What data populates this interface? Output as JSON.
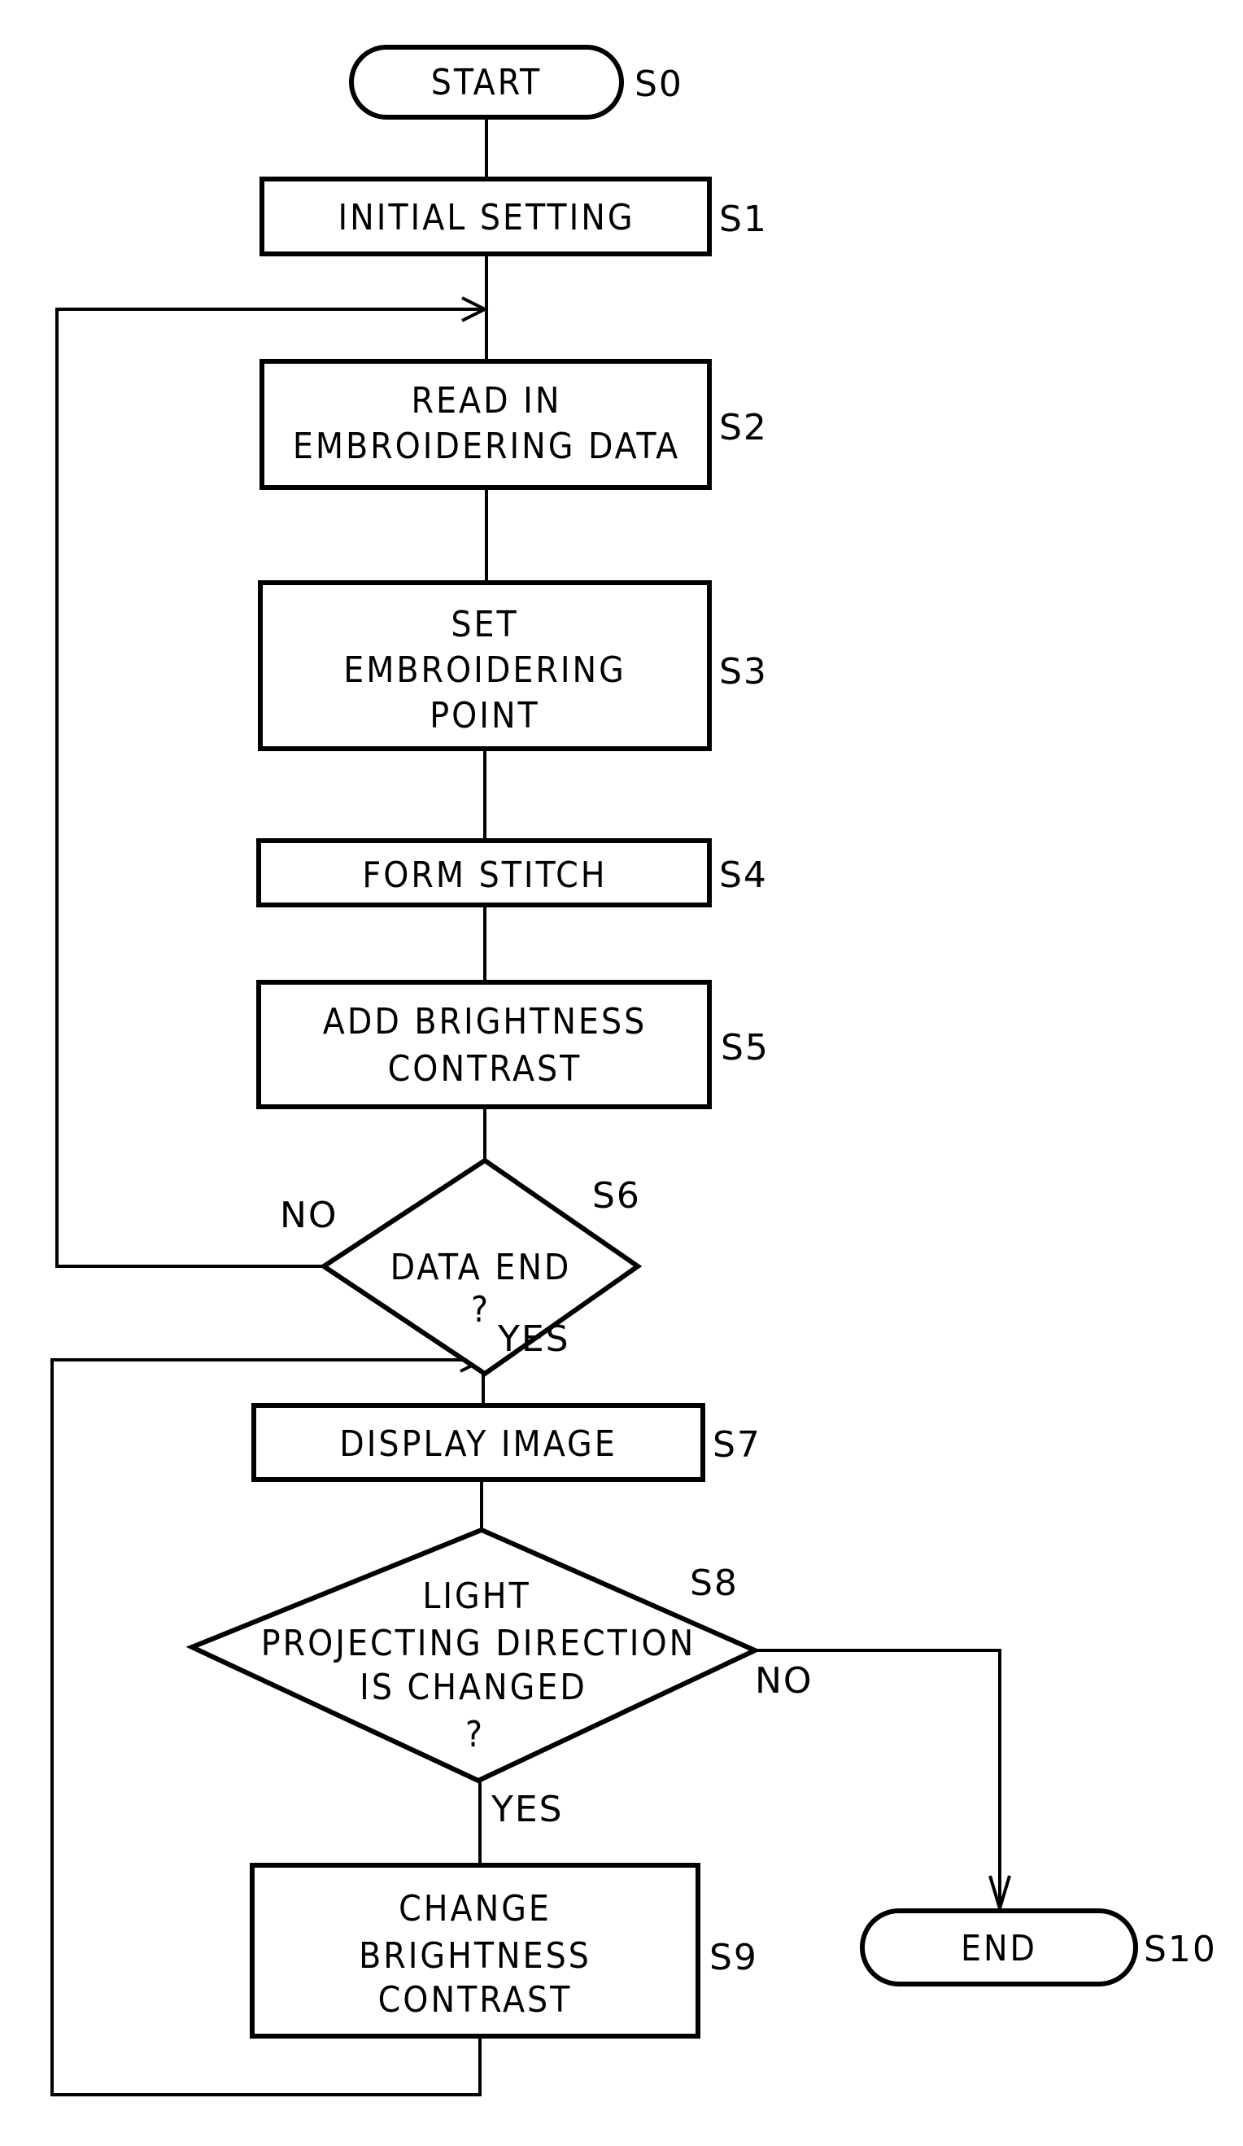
{
  "figure": {
    "type": "flowchart",
    "nodes": [
      {
        "id": "S0",
        "kind": "terminal",
        "lines": [
          "START"
        ]
      },
      {
        "id": "S1",
        "kind": "process",
        "lines": [
          "INITIAL SETTING"
        ]
      },
      {
        "id": "S2",
        "kind": "process",
        "lines": [
          "READ IN",
          "EMBROIDERING DATA"
        ]
      },
      {
        "id": "S3",
        "kind": "process",
        "lines": [
          "SET",
          "EMBROIDERING",
          "POINT"
        ]
      },
      {
        "id": "S4",
        "kind": "process",
        "lines": [
          "FORM STITCH"
        ]
      },
      {
        "id": "S5",
        "kind": "process",
        "lines": [
          "ADD BRIGHTNESS",
          "CONTRAST"
        ]
      },
      {
        "id": "S6",
        "kind": "decision",
        "lines": [
          "DATA END",
          "?"
        ]
      },
      {
        "id": "S7",
        "kind": "process",
        "lines": [
          "DISPLAY IMAGE"
        ]
      },
      {
        "id": "S8",
        "kind": "decision",
        "lines": [
          "LIGHT",
          "PROJECTING DIRECTION",
          "IS CHANGED",
          "?"
        ]
      },
      {
        "id": "S9",
        "kind": "process",
        "lines": [
          "CHANGE",
          "BRIGHTNESS",
          "CONTRAST"
        ]
      },
      {
        "id": "S10",
        "kind": "terminal",
        "lines": [
          "END"
        ]
      }
    ],
    "edges": [
      {
        "from": "S0",
        "to": "S1",
        "label": ""
      },
      {
        "from": "S1",
        "to": "S2",
        "label": ""
      },
      {
        "from": "S2",
        "to": "S3",
        "label": ""
      },
      {
        "from": "S3",
        "to": "S4",
        "label": ""
      },
      {
        "from": "S4",
        "to": "S5",
        "label": ""
      },
      {
        "from": "S5",
        "to": "S6",
        "label": ""
      },
      {
        "from": "S6",
        "to": "S2",
        "label": "NO"
      },
      {
        "from": "S6",
        "to": "S7",
        "label": "YES"
      },
      {
        "from": "S7",
        "to": "S8",
        "label": ""
      },
      {
        "from": "S8",
        "to": "S9",
        "label": "YES"
      },
      {
        "from": "S8",
        "to": "S10",
        "label": "NO"
      },
      {
        "from": "S9",
        "to": "S7",
        "label": ""
      }
    ],
    "branch_labels": {
      "no": "NO",
      "yes": "YES"
    }
  }
}
